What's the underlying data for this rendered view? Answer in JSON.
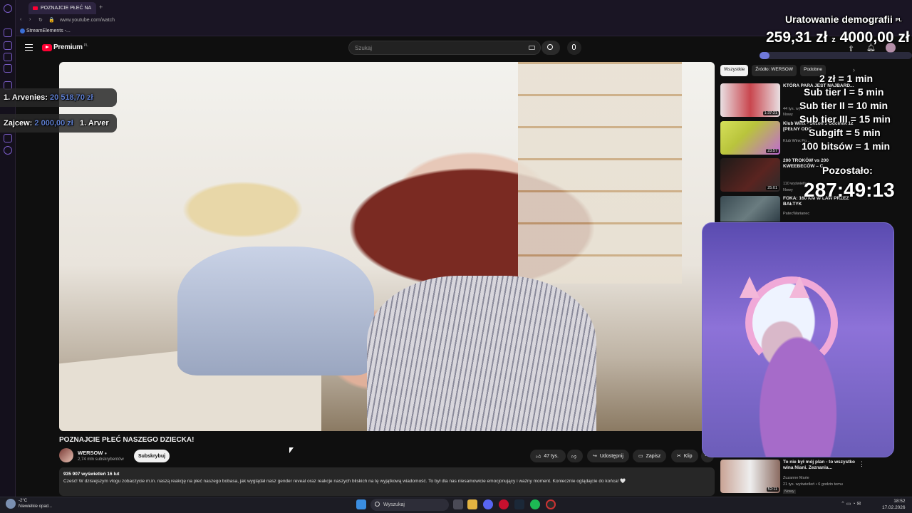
{
  "browser": {
    "tab_title": "POZNAJCIE PŁEĆ NA",
    "url": "www.youtube.com/watch",
    "bookmark": "StreamElements -..."
  },
  "youtube": {
    "logo": "Premium",
    "logo_suffix": "PL",
    "search_placeholder": "Szukaj",
    "video_title": "POZNAJCIE PŁEĆ NASZEGO DZIECKA!",
    "channel_name": "WERSOW",
    "channel_subs": "2,74 mln subskrybentów",
    "subscribe_label": "Subskrybuj",
    "likes": "47 tys.",
    "share_label": "Udostępnij",
    "save_label": "Zapisz",
    "clip_label": "Klip",
    "views_date": "935 907 wyświetleń  16 lut",
    "description": "Cześć! W dzisiejszym vlogu zobaczycie m.in. naszą reakcję na płeć naszego bobasa, jak wyglądał nasz gender reveal oraz reakcje naszych bliskich na tę wyjątkową wiadomość. To był dla nas niesamowicie emocjonujący i ważny moment. Koniecznie oglądajcie do końca! 🤍"
  },
  "chips": [
    "Wszystkie",
    "Źródło: WERSOW",
    "Podobne"
  ],
  "recommendations": [
    {
      "title": "KTÓRA PARA JEST NAJBARD...",
      "meta": "44 tys. wyśw.",
      "badge": "Nowy",
      "duration": "1:37:21",
      "color": "#c9464e"
    },
    {
      "title": "Klub Winx - Sezon 3 Odcinek 12 [PEŁNY ODC...",
      "meta": "Klub Winx Po...",
      "badge": "",
      "duration": "23:57",
      "color": "#b9c43c"
    },
    {
      "title": "200 TROKÓW vs 200 KWEEBECÓW – C...",
      "meta": "110 wyświetleń",
      "badge": "Nowy",
      "duration": "25:01",
      "color": "#3b2a2a"
    },
    {
      "title": "FOKA: 160 KM W LAW PRZEZ BAŁTYK",
      "meta": "PatecWarianec",
      "badge": "",
      "duration": "",
      "color": "#3a4b52"
    },
    {
      "title": "To nie był mój plan - to wszystko wina Niani. Zeznania...",
      "meta": "Zuzanne Marie",
      "meta2": "21 tys. wyświetleń • 6 godzin temu",
      "badge": "Nowy",
      "duration": "52:11",
      "color": "#c9a395"
    }
  ],
  "overlay": {
    "goal_title": "Uratowanie demografii",
    "goal_title_suffix": "PL",
    "goal_current": "259,31 zł",
    "goal_sep": "z",
    "goal_target": "4000,00 zł",
    "goal_progress": 0.065,
    "rules": [
      "2 zł = 1 min",
      "Sub tier I = 5 min",
      "Sub tier II = 10 min",
      "Sub tier III = 15 min",
      "Subgift = 5 min",
      "100 bitsów = 1 min"
    ],
    "timer_label": "Pozostało:",
    "timer_value": "287:49:13",
    "donor1_name": "1. Arvenies:",
    "donor1_amount": "20 518,70 zł",
    "donor2_name": "Zajcew:",
    "donor2_amount": "2 000,00 zł",
    "donor2_next": "1. Arver"
  },
  "taskbar": {
    "weather_temp": "-2°C",
    "weather_desc": "Niewielkie opad...",
    "search": "Wyszukaj",
    "time": "18:52",
    "date": "17.02.2026"
  },
  "colors": {
    "accent": "#7a5cc8",
    "goal_fill": "#6f78d9",
    "yt_red": "#ff0033"
  }
}
